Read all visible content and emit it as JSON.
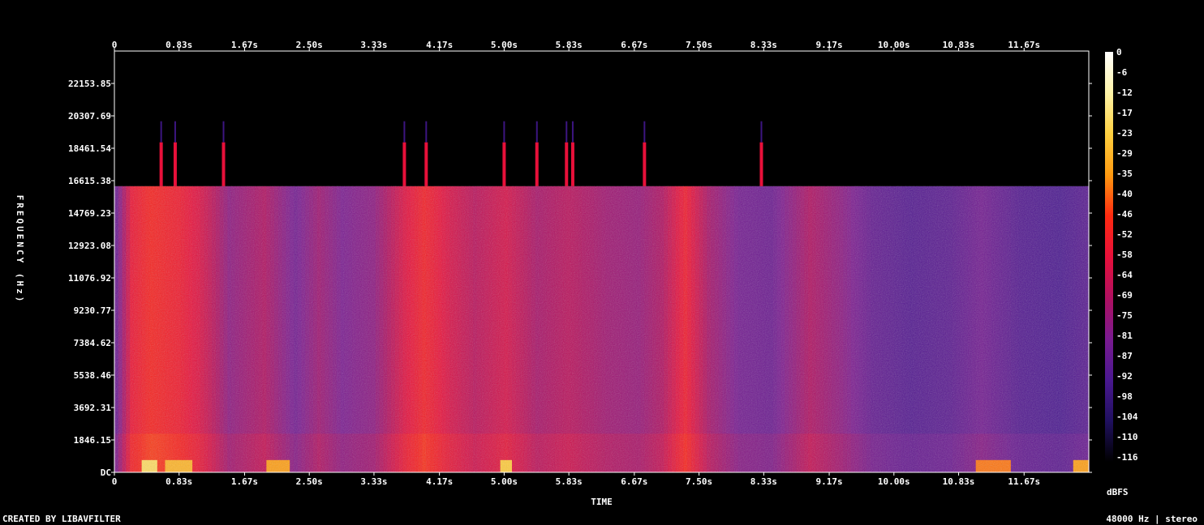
{
  "footer": {
    "credit": "CREATED BY LIBAVFILTER",
    "format": "48000 Hz | stereo"
  },
  "chart_data": {
    "type": "heatmap",
    "xlabel": "TIME",
    "ylabel": "FREQUENCY (Hz)",
    "colorbar_label": "dBFS",
    "x_ticks": [
      "0",
      "0.83s",
      "1.67s",
      "2.50s",
      "3.33s",
      "4.17s",
      "5.00s",
      "5.83s",
      "6.67s",
      "7.50s",
      "8.33s",
      "9.17s",
      "10.00s",
      "10.83s",
      "11.67s"
    ],
    "x_tick_values": [
      0,
      0.83,
      1.67,
      2.5,
      3.33,
      4.17,
      5.0,
      5.83,
      6.67,
      7.5,
      8.33,
      9.17,
      10.0,
      10.83,
      11.67
    ],
    "x_range": [
      0,
      12.5
    ],
    "y_ticks": [
      "DC",
      "1846.15",
      "3692.31",
      "5538.46",
      "7384.62",
      "9230.77",
      "11076.92",
      "12923.08",
      "14769.23",
      "16615.38",
      "18461.54",
      "20307.69",
      "22153.85"
    ],
    "y_tick_values": [
      0,
      1846.15,
      3692.31,
      5538.46,
      7384.62,
      9230.77,
      11076.92,
      12923.08,
      14769.23,
      16615.38,
      18461.54,
      20307.69,
      22153.85
    ],
    "y_range": [
      0,
      24000
    ],
    "colorbar_ticks": [
      "0",
      "-6",
      "-12",
      "-17",
      "-23",
      "-29",
      "-35",
      "-40",
      "-46",
      "-52",
      "-58",
      "-64",
      "-69",
      "-75",
      "-81",
      "-87",
      "-92",
      "-98",
      "-104",
      "-110",
      "-116"
    ],
    "colorbar_range": [
      0,
      -120
    ],
    "cutoff_frequency_hz": 16300,
    "energy_by_time": [
      {
        "t": 0.0,
        "level": -88
      },
      {
        "t": 0.2,
        "level": -58
      },
      {
        "t": 0.45,
        "level": -52
      },
      {
        "t": 0.8,
        "level": -56
      },
      {
        "t": 1.05,
        "level": -62
      },
      {
        "t": 1.25,
        "level": -70
      },
      {
        "t": 1.45,
        "level": -80
      },
      {
        "t": 1.9,
        "level": -72
      },
      {
        "t": 2.3,
        "level": -86
      },
      {
        "t": 2.6,
        "level": -76
      },
      {
        "t": 2.9,
        "level": -84
      },
      {
        "t": 3.3,
        "level": -80
      },
      {
        "t": 3.7,
        "level": -62
      },
      {
        "t": 3.95,
        "level": -54
      },
      {
        "t": 4.3,
        "level": -64
      },
      {
        "t": 4.6,
        "level": -70
      },
      {
        "t": 5.0,
        "level": -64
      },
      {
        "t": 5.4,
        "level": -74
      },
      {
        "t": 5.8,
        "level": -70
      },
      {
        "t": 6.3,
        "level": -76
      },
      {
        "t": 6.7,
        "level": -78
      },
      {
        "t": 7.0,
        "level": -72
      },
      {
        "t": 7.3,
        "level": -56
      },
      {
        "t": 7.6,
        "level": -74
      },
      {
        "t": 8.0,
        "level": -86
      },
      {
        "t": 8.4,
        "level": -88
      },
      {
        "t": 8.9,
        "level": -72
      },
      {
        "t": 9.3,
        "level": -80
      },
      {
        "t": 9.7,
        "level": -90
      },
      {
        "t": 10.2,
        "level": -94
      },
      {
        "t": 10.7,
        "level": -92
      },
      {
        "t": 11.1,
        "level": -86
      },
      {
        "t": 11.6,
        "level": -94
      },
      {
        "t": 12.1,
        "level": -96
      },
      {
        "t": 12.5,
        "level": -92
      }
    ],
    "spikes_time": [
      0.6,
      0.78,
      1.4,
      3.72,
      4.0,
      5.0,
      5.42,
      5.8,
      5.88,
      6.8,
      8.3
    ],
    "low_freq_bursts": [
      {
        "t0": 0.35,
        "t1": 0.55,
        "level": -20
      },
      {
        "t0": 0.65,
        "t1": 1.0,
        "level": -30
      },
      {
        "t0": 1.95,
        "t1": 2.25,
        "level": -35
      },
      {
        "t0": 4.95,
        "t1": 5.1,
        "level": -25
      },
      {
        "t0": 11.05,
        "t1": 11.5,
        "level": -40
      },
      {
        "t0": 12.3,
        "t1": 12.5,
        "level": -35
      }
    ]
  }
}
